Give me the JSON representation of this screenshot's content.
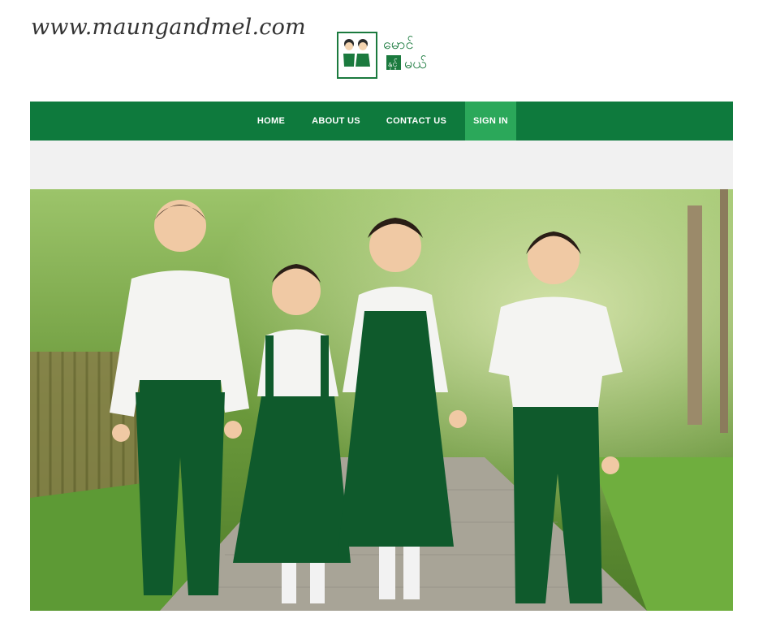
{
  "header": {
    "site_url": "www.maungandmel.com",
    "logo": {
      "icon": "children-logo-icon",
      "text_line1": "မောင်",
      "text_line2": "နှင့်",
      "text_line3": "မယ်"
    }
  },
  "nav": {
    "items": [
      {
        "label": "HOME",
        "active": false
      },
      {
        "label": "ABOUT US",
        "active": false
      },
      {
        "label": "CONTACT US",
        "active": false
      },
      {
        "label": "SIGN IN",
        "active": true
      }
    ]
  },
  "hero": {
    "image": "four children in white shirts and green school uniforms walking hand in hand on a garden path"
  },
  "colors": {
    "nav_bg": "#0e7a3d",
    "nav_active": "#2ba85a",
    "band_bg": "#f1f1f1",
    "uniform_green": "#0f5a2c"
  }
}
